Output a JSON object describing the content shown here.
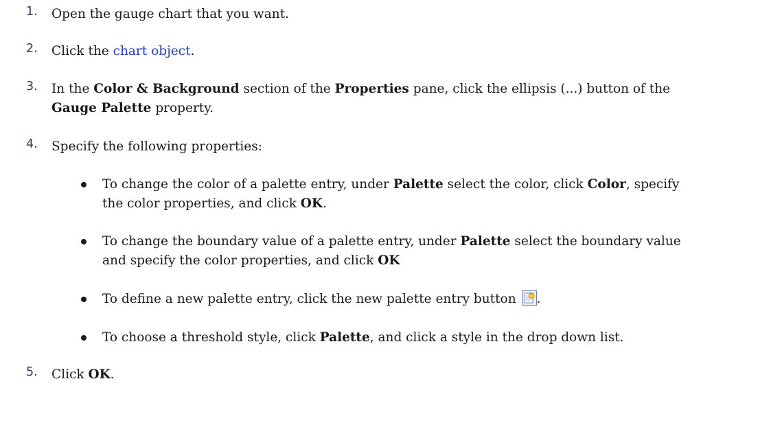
{
  "steps": [
    {
      "num": "1.",
      "pre": "Open the gauge chart that you want."
    },
    {
      "num": "2.",
      "pre": "Click the ",
      "link": "chart object",
      "post": "."
    },
    {
      "num": "3.",
      "p1": "In the ",
      "b1": "Color & Background",
      "p2": " section of the ",
      "b2": "Properties",
      "p3": " pane, click the ellipsis (...) button of the",
      "b3": "Gauge Palette",
      "p4": " property."
    },
    {
      "num": "4.",
      "pre": "Specify the following properties:"
    },
    {
      "num": "5.",
      "pre": "Click ",
      "b1": "OK",
      "post": "."
    }
  ],
  "bullets": [
    {
      "p1": "To change the color of a palette entry, under ",
      "b1": "Palette",
      "p2": " select the color, click ",
      "b2": "Color",
      "p3": ", specify",
      "p4": "the color properties, and click ",
      "b3": "OK",
      "p5": "."
    },
    {
      "p1": "To change the boundary value of a palette entry, under ",
      "b1": "Palette",
      "p2": " select the boundary value",
      "p3": "and specify the color properties, and click ",
      "b2": "OK"
    },
    {
      "p1": "To define a new palette entry, click the new palette entry button ",
      "icon": "new-palette-entry-icon",
      "p2": "."
    },
    {
      "p1": "To choose a threshold style, click ",
      "b1": "Palette",
      "p2": ", and click a style in the drop down list."
    }
  ]
}
